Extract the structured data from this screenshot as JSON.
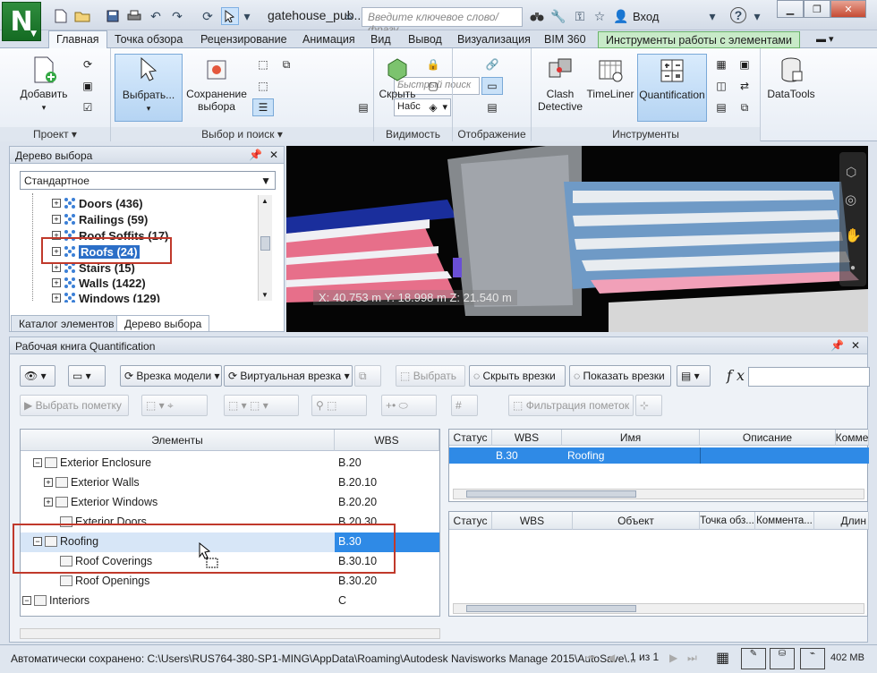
{
  "titlebar": {
    "app_logo": "N",
    "document_title": "gatehouse_pub...",
    "search_placeholder": "Введите ключевое слово/фразу",
    "login": "Вход",
    "help": "?"
  },
  "ribbon_tabs": [
    "Главная",
    "Точка обзора",
    "Рецензирование",
    "Анимация",
    "Вид",
    "Вывод",
    "Визуализация",
    "BIM 360",
    "Инструменты работы с элементами"
  ],
  "ribbon": {
    "project": {
      "add_label": "Добавить",
      "group_label": "Проект"
    },
    "select": {
      "select_label": "Выбрать...",
      "save_selection_label_1": "Сохранение",
      "save_selection_label_2": "выбора",
      "quick_find_placeholder": "Быстрый поиск",
      "sets_combo": "Набс",
      "group_label": "Выбор и поиск"
    },
    "visibility": {
      "hide_label": "Скрыть",
      "group_label": "Видимость"
    },
    "display": {
      "group_label": "Отображение"
    },
    "tools": {
      "clash_label_1": "Clash",
      "clash_label_2": "Detective",
      "timeliner_label": "TimeLiner",
      "quantification_label": "Quantification",
      "datatools_label": "DataTools",
      "group_label": "Инструменты"
    }
  },
  "selection_tree": {
    "title": "Дерево выбора",
    "mode": "Стандартное",
    "items": [
      {
        "label": "Doors (436)"
      },
      {
        "label": "Railings (59)"
      },
      {
        "label": "Roof Soffits (17)"
      },
      {
        "label": "Roofs (24)"
      },
      {
        "label": "Stairs (15)"
      },
      {
        "label": "Walls (1422)"
      },
      {
        "label": "Windows (129)"
      }
    ],
    "tabs": [
      "Каталог элементов",
      "Дерево выбора"
    ]
  },
  "viewport": {
    "coordinates": "X: 40.753 m  Y: 18.998 m  Z: 21.540 m"
  },
  "quantification": {
    "title": "Рабочая книга Quantification",
    "toolbar": {
      "model_takeoff": "Врезка модели",
      "virtual_takeoff": "Виртуальная врезка",
      "select": "Выбрать",
      "hide_takeoffs": "Скрыть врезки",
      "show_takeoffs": "Показать врезки",
      "select_markup": "Выбрать пометку",
      "filter_markups": "Фильтрация пометок",
      "fx": "f x"
    },
    "tree_headers": {
      "items": "Элементы",
      "wbs": "WBS"
    },
    "tree_rows": [
      {
        "name": "Exterior Enclosure",
        "wbs": "B.20"
      },
      {
        "name": "Exterior Walls",
        "wbs": "B.20.10"
      },
      {
        "name": "Exterior Windows",
        "wbs": "B.20.20"
      },
      {
        "name": "Exterior Doors",
        "wbs": "B.20.30"
      },
      {
        "name": "Roofing",
        "wbs": "B.30"
      },
      {
        "name": "Roof Coverings",
        "wbs": "B.30.10"
      },
      {
        "name": "Roof Openings",
        "wbs": "B.30.20"
      },
      {
        "name": "Interiors",
        "wbs": "C"
      }
    ],
    "top_grid": {
      "headers": [
        "Статус",
        "WBS",
        "Имя",
        "Описание",
        "Комме"
      ],
      "row": {
        "status": "",
        "wbs": "B.30",
        "name": "Roofing",
        "description": "",
        "comment": ""
      }
    },
    "bottom_grid": {
      "headers": [
        "Статус",
        "WBS",
        "Объект",
        "Точка обз...",
        "Коммента...",
        "Длин"
      ]
    }
  },
  "statusbar": {
    "autosave": "Автоматически сохранено: C:\\Users\\RUS764-380-SP1-MING\\AppData\\Roaming\\Autodesk Navisworks Manage 2015\\AutoSave\\...",
    "page": "1 из 1",
    "memory": "402 MB"
  },
  "colors": {
    "accent": "#2f8ae6",
    "selection": "#2b6ec7",
    "context_tab": "#c8eac8",
    "highlight_box": "#c0392b"
  }
}
